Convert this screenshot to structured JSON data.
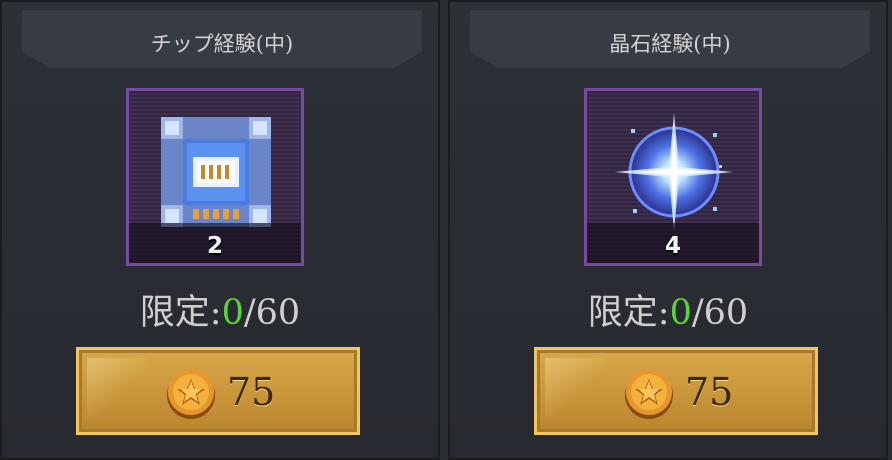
{
  "shop": {
    "items": [
      {
        "title": "チップ経験(中)",
        "icon": "chip-icon",
        "quantity": "2",
        "limit_label": "限定:",
        "limit_current": "0",
        "limit_max": "/60",
        "price": "75",
        "currency_icon": "star-coin-icon"
      },
      {
        "title": "晶石経験(中)",
        "icon": "crystal-burst-icon",
        "quantity": "4",
        "limit_label": "限定:",
        "limit_current": "0",
        "limit_max": "/60",
        "price": "75",
        "currency_icon": "star-coin-icon"
      }
    ],
    "colors": {
      "background": "#2a2d33",
      "frame_purple": "#7a4a9e",
      "limit_current_green": "#5fd33a",
      "button_gold": "#d8a84a"
    }
  }
}
